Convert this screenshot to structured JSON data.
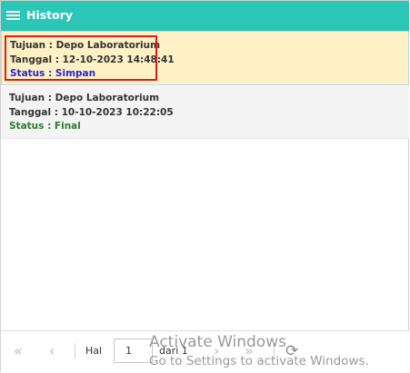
{
  "header": {
    "title": "History",
    "icon": "menu-icon"
  },
  "items": [
    {
      "tujuan": "Tujuan : Depo Laboratorium",
      "tanggal": "Tanggal : 12-10-2023 14:48:41",
      "status": "Status : Simpan",
      "status_color": "#2b22d6",
      "selected": true
    },
    {
      "tujuan": "Tujuan : Depo Laboratorium",
      "tanggal": "Tanggal : 10-10-2023 10:22:05",
      "status": "Status : Final",
      "status_color": "#2f7a2f",
      "selected": false
    }
  ],
  "pager": {
    "first_icon": "«",
    "prev_icon": "‹",
    "page_label": "Hal",
    "page_value": "1",
    "of_label": "dari 1",
    "next_icon": "›",
    "last_icon": "»",
    "refresh_icon": "⟳"
  },
  "watermark": {
    "line1": "Activate Windows",
    "line2": "Go to Settings to activate Windows."
  },
  "colors": {
    "header_bg": "#2cc6b7",
    "selected_bg": "#fdf1c5",
    "highlight_border": "#e31b1b"
  }
}
